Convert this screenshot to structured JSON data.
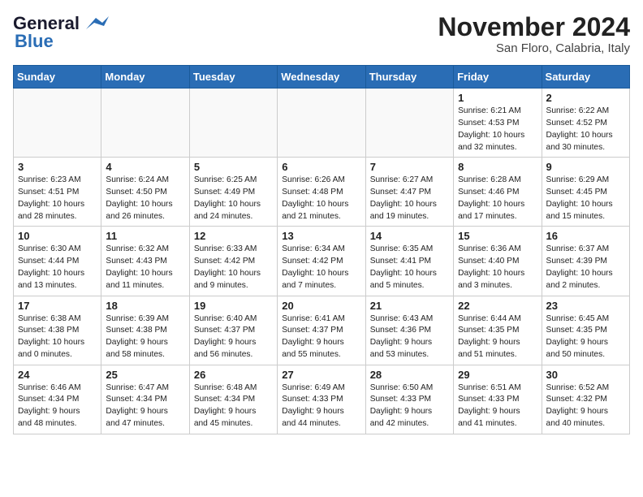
{
  "header": {
    "logo_line1": "General",
    "logo_line2": "Blue",
    "month": "November 2024",
    "location": "San Floro, Calabria, Italy"
  },
  "weekdays": [
    "Sunday",
    "Monday",
    "Tuesday",
    "Wednesday",
    "Thursday",
    "Friday",
    "Saturday"
  ],
  "weeks": [
    [
      {
        "day": "",
        "info": ""
      },
      {
        "day": "",
        "info": ""
      },
      {
        "day": "",
        "info": ""
      },
      {
        "day": "",
        "info": ""
      },
      {
        "day": "",
        "info": ""
      },
      {
        "day": "1",
        "info": "Sunrise: 6:21 AM\nSunset: 4:53 PM\nDaylight: 10 hours\nand 32 minutes."
      },
      {
        "day": "2",
        "info": "Sunrise: 6:22 AM\nSunset: 4:52 PM\nDaylight: 10 hours\nand 30 minutes."
      }
    ],
    [
      {
        "day": "3",
        "info": "Sunrise: 6:23 AM\nSunset: 4:51 PM\nDaylight: 10 hours\nand 28 minutes."
      },
      {
        "day": "4",
        "info": "Sunrise: 6:24 AM\nSunset: 4:50 PM\nDaylight: 10 hours\nand 26 minutes."
      },
      {
        "day": "5",
        "info": "Sunrise: 6:25 AM\nSunset: 4:49 PM\nDaylight: 10 hours\nand 24 minutes."
      },
      {
        "day": "6",
        "info": "Sunrise: 6:26 AM\nSunset: 4:48 PM\nDaylight: 10 hours\nand 21 minutes."
      },
      {
        "day": "7",
        "info": "Sunrise: 6:27 AM\nSunset: 4:47 PM\nDaylight: 10 hours\nand 19 minutes."
      },
      {
        "day": "8",
        "info": "Sunrise: 6:28 AM\nSunset: 4:46 PM\nDaylight: 10 hours\nand 17 minutes."
      },
      {
        "day": "9",
        "info": "Sunrise: 6:29 AM\nSunset: 4:45 PM\nDaylight: 10 hours\nand 15 minutes."
      }
    ],
    [
      {
        "day": "10",
        "info": "Sunrise: 6:30 AM\nSunset: 4:44 PM\nDaylight: 10 hours\nand 13 minutes."
      },
      {
        "day": "11",
        "info": "Sunrise: 6:32 AM\nSunset: 4:43 PM\nDaylight: 10 hours\nand 11 minutes."
      },
      {
        "day": "12",
        "info": "Sunrise: 6:33 AM\nSunset: 4:42 PM\nDaylight: 10 hours\nand 9 minutes."
      },
      {
        "day": "13",
        "info": "Sunrise: 6:34 AM\nSunset: 4:42 PM\nDaylight: 10 hours\nand 7 minutes."
      },
      {
        "day": "14",
        "info": "Sunrise: 6:35 AM\nSunset: 4:41 PM\nDaylight: 10 hours\nand 5 minutes."
      },
      {
        "day": "15",
        "info": "Sunrise: 6:36 AM\nSunset: 4:40 PM\nDaylight: 10 hours\nand 3 minutes."
      },
      {
        "day": "16",
        "info": "Sunrise: 6:37 AM\nSunset: 4:39 PM\nDaylight: 10 hours\nand 2 minutes."
      }
    ],
    [
      {
        "day": "17",
        "info": "Sunrise: 6:38 AM\nSunset: 4:38 PM\nDaylight: 10 hours\nand 0 minutes."
      },
      {
        "day": "18",
        "info": "Sunrise: 6:39 AM\nSunset: 4:38 PM\nDaylight: 9 hours\nand 58 minutes."
      },
      {
        "day": "19",
        "info": "Sunrise: 6:40 AM\nSunset: 4:37 PM\nDaylight: 9 hours\nand 56 minutes."
      },
      {
        "day": "20",
        "info": "Sunrise: 6:41 AM\nSunset: 4:37 PM\nDaylight: 9 hours\nand 55 minutes."
      },
      {
        "day": "21",
        "info": "Sunrise: 6:43 AM\nSunset: 4:36 PM\nDaylight: 9 hours\nand 53 minutes."
      },
      {
        "day": "22",
        "info": "Sunrise: 6:44 AM\nSunset: 4:35 PM\nDaylight: 9 hours\nand 51 minutes."
      },
      {
        "day": "23",
        "info": "Sunrise: 6:45 AM\nSunset: 4:35 PM\nDaylight: 9 hours\nand 50 minutes."
      }
    ],
    [
      {
        "day": "24",
        "info": "Sunrise: 6:46 AM\nSunset: 4:34 PM\nDaylight: 9 hours\nand 48 minutes."
      },
      {
        "day": "25",
        "info": "Sunrise: 6:47 AM\nSunset: 4:34 PM\nDaylight: 9 hours\nand 47 minutes."
      },
      {
        "day": "26",
        "info": "Sunrise: 6:48 AM\nSunset: 4:34 PM\nDaylight: 9 hours\nand 45 minutes."
      },
      {
        "day": "27",
        "info": "Sunrise: 6:49 AM\nSunset: 4:33 PM\nDaylight: 9 hours\nand 44 minutes."
      },
      {
        "day": "28",
        "info": "Sunrise: 6:50 AM\nSunset: 4:33 PM\nDaylight: 9 hours\nand 42 minutes."
      },
      {
        "day": "29",
        "info": "Sunrise: 6:51 AM\nSunset: 4:33 PM\nDaylight: 9 hours\nand 41 minutes."
      },
      {
        "day": "30",
        "info": "Sunrise: 6:52 AM\nSunset: 4:32 PM\nDaylight: 9 hours\nand 40 minutes."
      }
    ]
  ]
}
